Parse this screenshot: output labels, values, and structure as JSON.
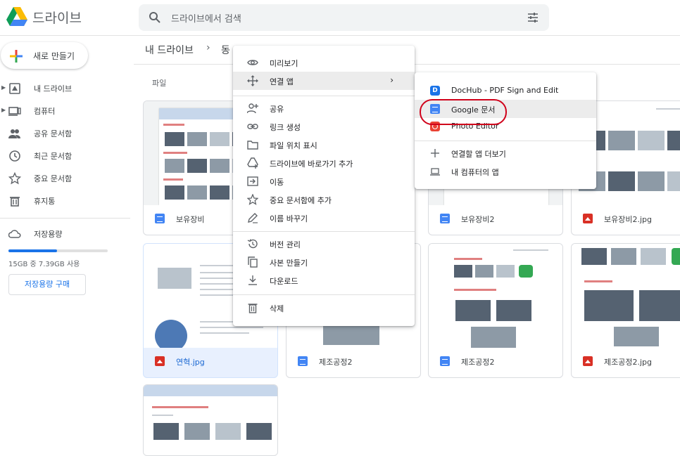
{
  "app": {
    "title": "드라이브"
  },
  "search": {
    "placeholder": "드라이브에서 검색"
  },
  "sidebar": {
    "new_label": "새로 만들기",
    "items": [
      {
        "label": "내 드라이브",
        "icon": "drive-icon",
        "expandable": true
      },
      {
        "label": "컴퓨터",
        "icon": "computer-icon",
        "expandable": true
      },
      {
        "label": "공유 문서함",
        "icon": "shared-icon",
        "expandable": false
      },
      {
        "label": "최근 문서함",
        "icon": "clock-icon",
        "expandable": false
      },
      {
        "label": "중요 문서함",
        "icon": "star-icon",
        "expandable": false
      },
      {
        "label": "휴지통",
        "icon": "trash-icon",
        "expandable": false
      }
    ],
    "storage": {
      "label": "저장용량",
      "usage_text": "15GB 중 7.39GB 사용",
      "used_fraction": 0.49,
      "buy_label": "저장용량 구매"
    }
  },
  "breadcrumb": {
    "root": "내 드라이브",
    "separator": "›",
    "current": "동"
  },
  "section": {
    "files_label": "파일"
  },
  "files": [
    {
      "name": "보유장비",
      "type": "doc"
    },
    {
      "name": "보유장비2",
      "type": "doc"
    },
    {
      "name": "보유장비2.jpg",
      "type": "image"
    },
    {
      "name": "연혁.jpg",
      "type": "image",
      "selected": true
    },
    {
      "name": "제조공정2",
      "type": "doc"
    },
    {
      "name": "제조공정2",
      "type": "doc"
    },
    {
      "name": "제조공정2.jpg",
      "type": "image"
    }
  ],
  "context_menu": {
    "groups": [
      [
        {
          "label": "미리보기",
          "icon": "eye-icon"
        },
        {
          "label": "연결 앱",
          "icon": "move-arrows-icon",
          "submenu": true,
          "highlighted": true
        }
      ],
      [
        {
          "label": "공유",
          "icon": "person-add-icon"
        },
        {
          "label": "링크 생성",
          "icon": "link-icon"
        },
        {
          "label": "파일 위치 표시",
          "icon": "folder-icon"
        },
        {
          "label": "드라이브에 바로가기 추가",
          "icon": "drive-add-icon"
        },
        {
          "label": "이동",
          "icon": "move-icon"
        },
        {
          "label": "중요 문서함에 추가",
          "icon": "star-icon"
        },
        {
          "label": "이름 바꾸기",
          "icon": "pencil-icon"
        }
      ],
      [
        {
          "label": "버전 관리",
          "icon": "history-icon"
        },
        {
          "label": "사본 만들기",
          "icon": "copy-icon"
        },
        {
          "label": "다운로드",
          "icon": "download-icon"
        }
      ],
      [
        {
          "label": "삭제",
          "icon": "trash-icon"
        }
      ]
    ]
  },
  "submenu": {
    "apps": [
      {
        "label": "DocHub - PDF Sign and Edit",
        "icon": "dochub-icon",
        "color": "#1a73e8"
      },
      {
        "label": "Google 문서",
        "icon": "google-docs-icon",
        "color": "#4285f4",
        "highlighted": true
      },
      {
        "label": "Photo Editor",
        "icon": "photo-editor-icon",
        "color": "#ea4335"
      }
    ],
    "extras": [
      {
        "label": "연결할 앱 더보기",
        "icon": "plus-icon"
      },
      {
        "label": "내 컴퓨터의 앱",
        "icon": "laptop-icon"
      }
    ]
  },
  "colors": {
    "accent": "#1a73e8",
    "annotation": "#d0021b"
  }
}
